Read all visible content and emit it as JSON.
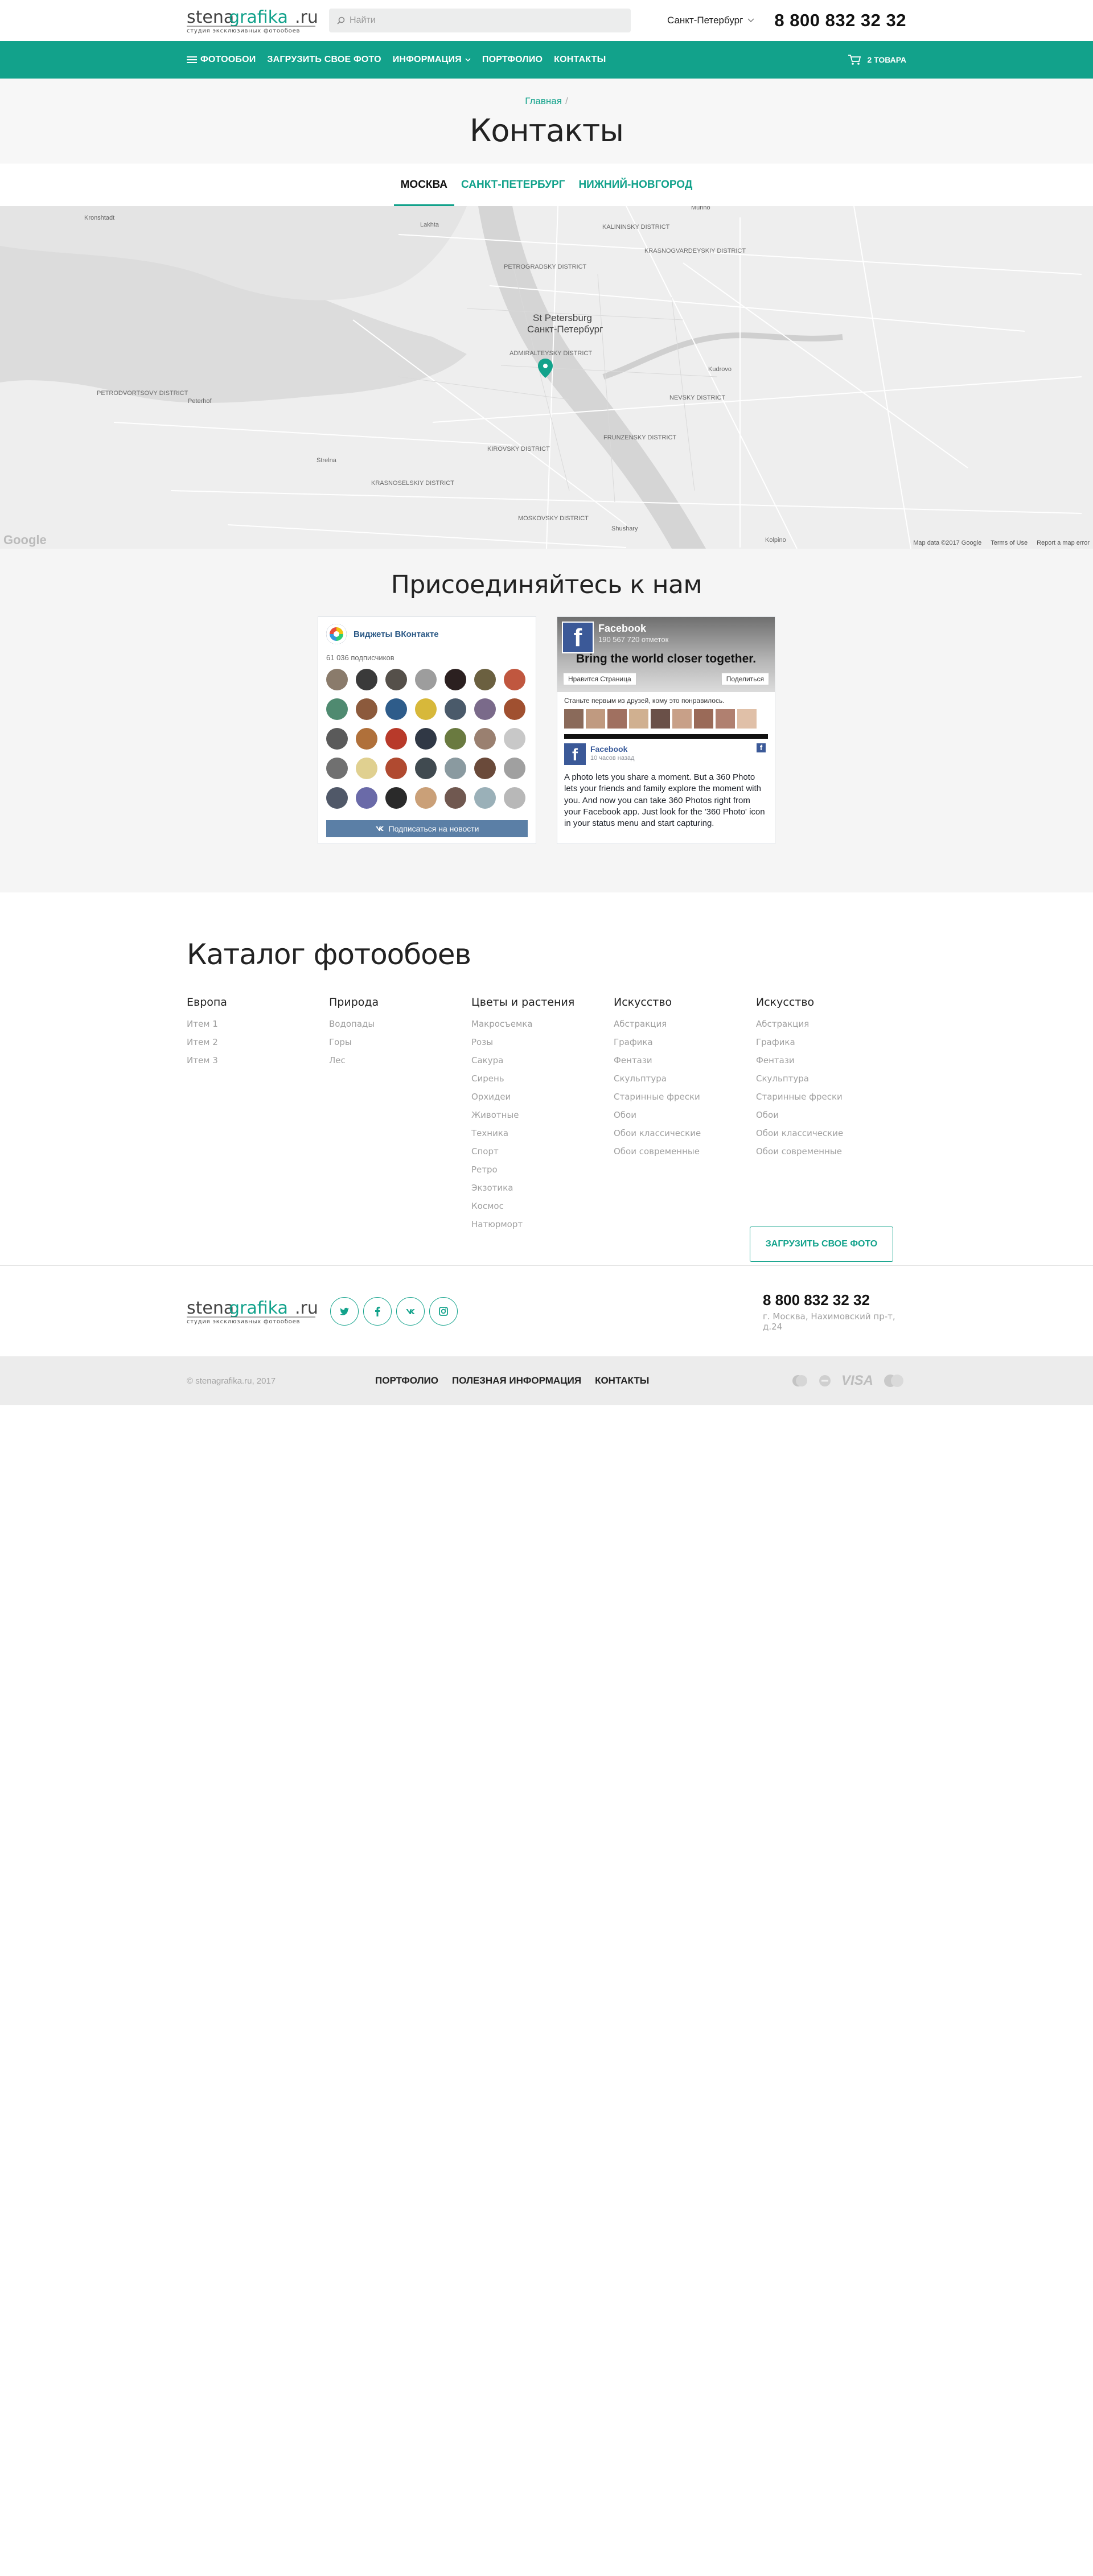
{
  "header": {
    "logo_text_main": "stena",
    "logo_text_accent": "grafika",
    "logo_text_tld": ".ru",
    "logo_tagline": "студия эксклюзивных фотообоев",
    "search_placeholder": "Найти",
    "city": "Санкт-Петербург",
    "phone": "8 800 832 32 32"
  },
  "nav": {
    "items": [
      {
        "label": "Фотообои"
      },
      {
        "label": "Загрузить свое фото"
      },
      {
        "label": "Информация"
      },
      {
        "label": "Портфолио"
      },
      {
        "label": "Контакты"
      }
    ],
    "cart_label": "2 товара"
  },
  "breadcrumb": {
    "home": "Главная",
    "separator": "/"
  },
  "page_title": "Контакты",
  "tabs": [
    {
      "label": "Москва",
      "active": true
    },
    {
      "label": "Санкт-Петербург",
      "active": false
    },
    {
      "label": "Нижний-Новгород",
      "active": false
    }
  ],
  "map": {
    "labels": [
      {
        "text": "St Petersburg"
      },
      {
        "text": "Санкт-Петербург"
      },
      {
        "text": "PETROGRADSKY DISTRICT"
      },
      {
        "text": "KALININSKY DISTRICT"
      },
      {
        "text": "KRASNOGVARDEYSKIY DISTRICT"
      },
      {
        "text": "ADMIRALTEYSKY DISTRICT"
      },
      {
        "text": "NEVSKY DISTRICT"
      },
      {
        "text": "FRUNZENSKY DISTRICT"
      },
      {
        "text": "KIROVSKY DISTRICT"
      },
      {
        "text": "KRASNOSELSKIY DISTRICT"
      },
      {
        "text": "MOSKOVSKY DISTRICT"
      },
      {
        "text": "PETRODVORTSOVY DISTRICT"
      },
      {
        "text": "Kronshtadt"
      },
      {
        "text": "Lakhta"
      },
      {
        "text": "Peterhof"
      },
      {
        "text": "Strelna"
      },
      {
        "text": "Kudrovo"
      },
      {
        "text": "Shushary"
      },
      {
        "text": "Murino"
      },
      {
        "text": "Kolpino"
      }
    ],
    "footer": [
      "Map data ©2017 Google",
      "Terms of Use",
      "Report a map error"
    ],
    "google": "Google"
  },
  "social": {
    "title": "Присоединяйтесь к нам",
    "vk": {
      "title": "Виджеты ВКонтакте",
      "subscribers": "61 036 подписчиков",
      "button": "Подписаться на новости"
    },
    "fb": {
      "page_name": "Facebook",
      "likes": "190 567 720 отметок",
      "slogan": "Bring the world closer together.",
      "like_btn": "Нравится Страница",
      "share_btn": "Поделиться",
      "friends_text": "Станьте первым из друзей, кому это понравилось.",
      "post_name": "Facebook",
      "post_time": "10 часов назад",
      "post_text": "A photo lets you share a moment. But a 360 Photo lets your friends and family explore the moment with you. And now you can take 360 Photos right from your Facebook app. Just look for the '360 Photo' icon in your status menu and start capturing."
    }
  },
  "catalog": {
    "title": "Каталог фотообоев",
    "columns": [
      {
        "heading": "Европа",
        "links": [
          "Итем 1",
          "Итем 2",
          "Итем 3"
        ]
      },
      {
        "heading": "Природа",
        "links": [
          "Водопады",
          "Горы",
          "Лес"
        ]
      },
      {
        "heading": "Цветы и растения",
        "links": [
          "Макросъемка",
          "Розы",
          "Сакура",
          "Сирень",
          "Орхидеи",
          "Животные",
          "Техника",
          "Спорт",
          "Ретро",
          "Экзотика",
          "Космос",
          "Натюрморт"
        ]
      },
      {
        "heading": "Искусство",
        "links": [
          "Абстракция",
          "Графика",
          "Фентази",
          "Скульптура",
          "Старинные фрески",
          "Обои",
          "Обои классические",
          "Обои современные"
        ]
      },
      {
        "heading": "Искусство",
        "links": [
          "Абстракция",
          "Графика",
          "Фентази",
          "Скульптура",
          "Старинные фрески",
          "Обои",
          "Обои классические",
          "Обои современные"
        ]
      }
    ],
    "upload_button": "Загрузить свое фото"
  },
  "footer": {
    "phone": "8 800 832 32 32",
    "address": "г. Москва, Нахимовский пр-т, д.24",
    "copyright": "© stenagrafika.ru, 2017",
    "links": [
      "Портфолио",
      "Полезная информация",
      "Контакты"
    ],
    "social_icons": [
      "twitter-icon",
      "facebook-icon",
      "vk-icon",
      "instagram-icon"
    ],
    "payment_visa": "VISA"
  },
  "colors": {
    "accent": "#12a28b",
    "nav_bg": "#12a28b",
    "vk_button": "#5b7fa6",
    "fb_blue": "#3b5998"
  }
}
